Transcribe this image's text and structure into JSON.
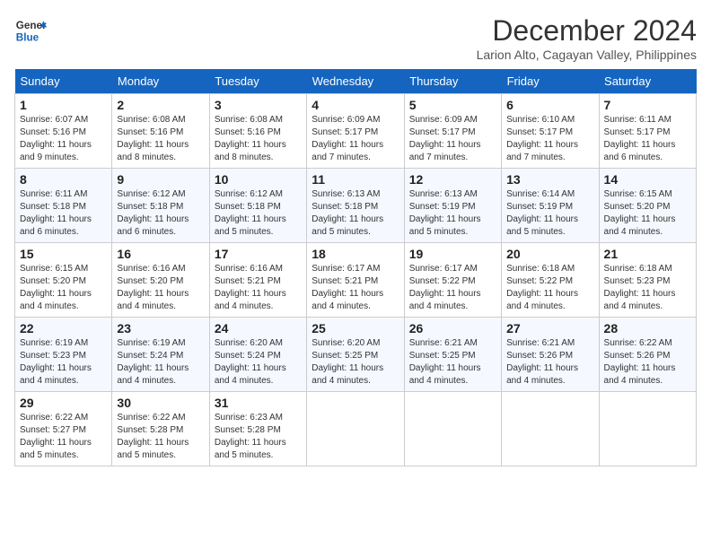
{
  "header": {
    "logo_line1": "General",
    "logo_line2": "Blue",
    "month_title": "December 2024",
    "location": "Larion Alto, Cagayan Valley, Philippines"
  },
  "days_of_week": [
    "Sunday",
    "Monday",
    "Tuesday",
    "Wednesday",
    "Thursday",
    "Friday",
    "Saturday"
  ],
  "weeks": [
    [
      {
        "day": "1",
        "sunrise": "6:07 AM",
        "sunset": "5:16 PM",
        "daylight": "11 hours and 9 minutes"
      },
      {
        "day": "2",
        "sunrise": "6:08 AM",
        "sunset": "5:16 PM",
        "daylight": "11 hours and 8 minutes"
      },
      {
        "day": "3",
        "sunrise": "6:08 AM",
        "sunset": "5:16 PM",
        "daylight": "11 hours and 8 minutes"
      },
      {
        "day": "4",
        "sunrise": "6:09 AM",
        "sunset": "5:17 PM",
        "daylight": "11 hours and 7 minutes"
      },
      {
        "day": "5",
        "sunrise": "6:09 AM",
        "sunset": "5:17 PM",
        "daylight": "11 hours and 7 minutes"
      },
      {
        "day": "6",
        "sunrise": "6:10 AM",
        "sunset": "5:17 PM",
        "daylight": "11 hours and 7 minutes"
      },
      {
        "day": "7",
        "sunrise": "6:11 AM",
        "sunset": "5:17 PM",
        "daylight": "11 hours and 6 minutes"
      }
    ],
    [
      {
        "day": "8",
        "sunrise": "6:11 AM",
        "sunset": "5:18 PM",
        "daylight": "11 hours and 6 minutes"
      },
      {
        "day": "9",
        "sunrise": "6:12 AM",
        "sunset": "5:18 PM",
        "daylight": "11 hours and 6 minutes"
      },
      {
        "day": "10",
        "sunrise": "6:12 AM",
        "sunset": "5:18 PM",
        "daylight": "11 hours and 5 minutes"
      },
      {
        "day": "11",
        "sunrise": "6:13 AM",
        "sunset": "5:18 PM",
        "daylight": "11 hours and 5 minutes"
      },
      {
        "day": "12",
        "sunrise": "6:13 AM",
        "sunset": "5:19 PM",
        "daylight": "11 hours and 5 minutes"
      },
      {
        "day": "13",
        "sunrise": "6:14 AM",
        "sunset": "5:19 PM",
        "daylight": "11 hours and 5 minutes"
      },
      {
        "day": "14",
        "sunrise": "6:15 AM",
        "sunset": "5:20 PM",
        "daylight": "11 hours and 4 minutes"
      }
    ],
    [
      {
        "day": "15",
        "sunrise": "6:15 AM",
        "sunset": "5:20 PM",
        "daylight": "11 hours and 4 minutes"
      },
      {
        "day": "16",
        "sunrise": "6:16 AM",
        "sunset": "5:20 PM",
        "daylight": "11 hours and 4 minutes"
      },
      {
        "day": "17",
        "sunrise": "6:16 AM",
        "sunset": "5:21 PM",
        "daylight": "11 hours and 4 minutes"
      },
      {
        "day": "18",
        "sunrise": "6:17 AM",
        "sunset": "5:21 PM",
        "daylight": "11 hours and 4 minutes"
      },
      {
        "day": "19",
        "sunrise": "6:17 AM",
        "sunset": "5:22 PM",
        "daylight": "11 hours and 4 minutes"
      },
      {
        "day": "20",
        "sunrise": "6:18 AM",
        "sunset": "5:22 PM",
        "daylight": "11 hours and 4 minutes"
      },
      {
        "day": "21",
        "sunrise": "6:18 AM",
        "sunset": "5:23 PM",
        "daylight": "11 hours and 4 minutes"
      }
    ],
    [
      {
        "day": "22",
        "sunrise": "6:19 AM",
        "sunset": "5:23 PM",
        "daylight": "11 hours and 4 minutes"
      },
      {
        "day": "23",
        "sunrise": "6:19 AM",
        "sunset": "5:24 PM",
        "daylight": "11 hours and 4 minutes"
      },
      {
        "day": "24",
        "sunrise": "6:20 AM",
        "sunset": "5:24 PM",
        "daylight": "11 hours and 4 minutes"
      },
      {
        "day": "25",
        "sunrise": "6:20 AM",
        "sunset": "5:25 PM",
        "daylight": "11 hours and 4 minutes"
      },
      {
        "day": "26",
        "sunrise": "6:21 AM",
        "sunset": "5:25 PM",
        "daylight": "11 hours and 4 minutes"
      },
      {
        "day": "27",
        "sunrise": "6:21 AM",
        "sunset": "5:26 PM",
        "daylight": "11 hours and 4 minutes"
      },
      {
        "day": "28",
        "sunrise": "6:22 AM",
        "sunset": "5:26 PM",
        "daylight": "11 hours and 4 minutes"
      }
    ],
    [
      {
        "day": "29",
        "sunrise": "6:22 AM",
        "sunset": "5:27 PM",
        "daylight": "11 hours and 5 minutes"
      },
      {
        "day": "30",
        "sunrise": "6:22 AM",
        "sunset": "5:28 PM",
        "daylight": "11 hours and 5 minutes"
      },
      {
        "day": "31",
        "sunrise": "6:23 AM",
        "sunset": "5:28 PM",
        "daylight": "11 hours and 5 minutes"
      },
      null,
      null,
      null,
      null
    ]
  ]
}
